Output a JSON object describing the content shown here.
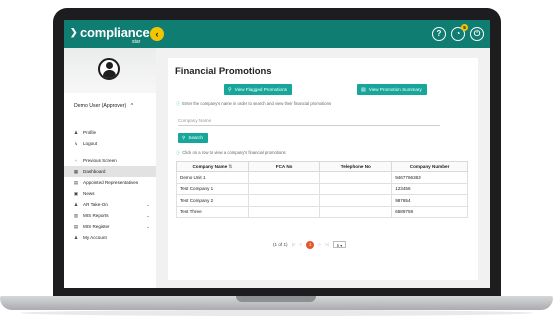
{
  "brand": {
    "name": "compliance",
    "sub": "star"
  },
  "topbar": {
    "collapse_icon": "chevron-left-icon",
    "icons": [
      {
        "name": "help-icon",
        "glyph": "?"
      },
      {
        "name": "notification-icon",
        "glyph": "◔",
        "badge": "5"
      },
      {
        "name": "power-icon",
        "glyph": "⏻"
      }
    ]
  },
  "user": {
    "name": "Demo User (Approver)",
    "caret": "^"
  },
  "sidebar": {
    "items": [
      {
        "label": "Profile",
        "icon": "person-icon",
        "glyph": "♟",
        "active": false,
        "caret": ""
      },
      {
        "label": "Logout",
        "icon": "logout-icon",
        "glyph": "↳",
        "active": false,
        "caret": ""
      },
      {
        "label": "Previous Screen",
        "icon": "back-icon",
        "glyph": "‹",
        "active": false,
        "caret": "",
        "gap": true
      },
      {
        "label": "Dashboard",
        "icon": "dashboard-icon",
        "glyph": "▦",
        "active": true,
        "caret": ""
      },
      {
        "label": "Appointed Representatives",
        "icon": "document-icon",
        "glyph": "▤",
        "active": false,
        "caret": ""
      },
      {
        "label": "News",
        "icon": "news-icon",
        "glyph": "▣",
        "active": false,
        "caret": ""
      },
      {
        "label": "AR Take-On",
        "icon": "users-icon",
        "glyph": "♟",
        "active": false,
        "caret": "⌄"
      },
      {
        "label": "MIS Reports",
        "icon": "chart-icon",
        "glyph": "▥",
        "active": false,
        "caret": "⌄"
      },
      {
        "label": "MIS Register",
        "icon": "register-icon",
        "glyph": "▤",
        "active": false,
        "caret": "⌄"
      },
      {
        "label": "My Account",
        "icon": "account-icon",
        "glyph": "♟",
        "active": false,
        "caret": ""
      }
    ]
  },
  "main": {
    "title": "Financial Promotions",
    "btn_flagged": "View Flagged Promotions",
    "btn_summary": "View Promotion Summary",
    "hint_search": "Enter the company's name in order to search and view their financial promotions",
    "company_placeholder": "Company Name",
    "search_label": "Search",
    "hint_click": "Click on a row to view a company's financial promotions"
  },
  "table": {
    "headers": [
      "Company Name",
      "FCA No",
      "Telephone No",
      "Company Number"
    ],
    "rows": [
      [
        "Demo Unit 1",
        "",
        "",
        "9467766363"
      ],
      [
        "Test Company 1",
        "",
        "",
        "123456"
      ],
      [
        "Test Company 2",
        "",
        "",
        "987654"
      ],
      [
        "Test Three",
        "",
        "",
        "6589759"
      ]
    ]
  },
  "pager": {
    "info": "(1 of 1)",
    "first": "|<",
    "prev": "<",
    "current": "1",
    "next": ">",
    "last": ">|",
    "page_size": "5"
  }
}
